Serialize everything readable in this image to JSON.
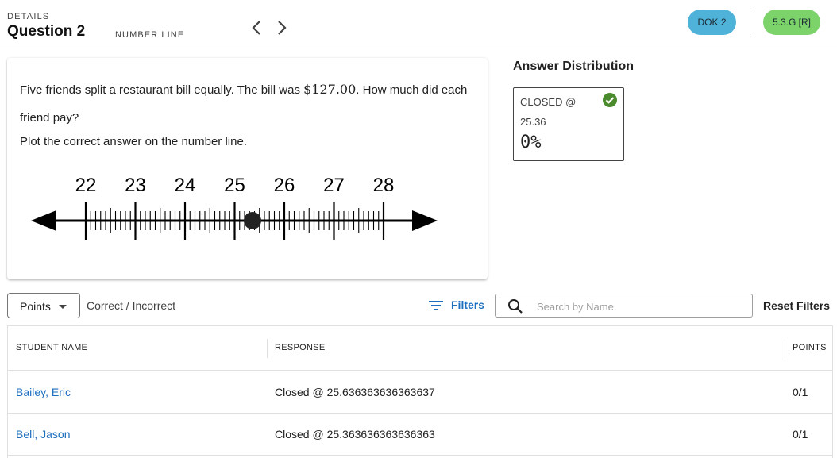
{
  "header": {
    "details_label": "DETAILS",
    "question_title": "Question 2",
    "question_type": "NUMBER LINE",
    "dok_chip": "DOK 2",
    "standard_chip": "5.3.G [R]",
    "colors": {
      "dok": "#4fb3d9",
      "standard": "#7bd36a"
    }
  },
  "question": {
    "text_before": "Five friends split a restaurant bill equally. The bill was ",
    "amount": "$127.00",
    "text_after": ". How much did each friend pay?",
    "instruction": "Plot the correct answer on the number line.",
    "number_line": {
      "labels": [
        "22",
        "23",
        "24",
        "25",
        "26",
        "27",
        "28"
      ],
      "min": 22,
      "max": 28,
      "minor_ticks_per_unit": 10,
      "plotted_point": 25.36
    }
  },
  "answer_distribution": {
    "title": "Answer Distribution",
    "label": "CLOSED @",
    "value": "25.36",
    "percent": "0%",
    "check_color": "#4b8b2e"
  },
  "toolbar": {
    "points_select": "Points",
    "correct_incorrect": "Correct / Incorrect",
    "filters": "Filters",
    "search_placeholder": "Search by Name",
    "reset_filters": "Reset Filters"
  },
  "table": {
    "headers": [
      "STUDENT NAME",
      "RESPONSE",
      "POINTS"
    ],
    "rows": [
      {
        "name": "Bailey, Eric",
        "response": "Closed @ 25.636363636363637",
        "points": "0/1"
      },
      {
        "name": "Bell, Jason",
        "response": "Closed @ 25.363636363636363",
        "points": "0/1"
      }
    ]
  }
}
